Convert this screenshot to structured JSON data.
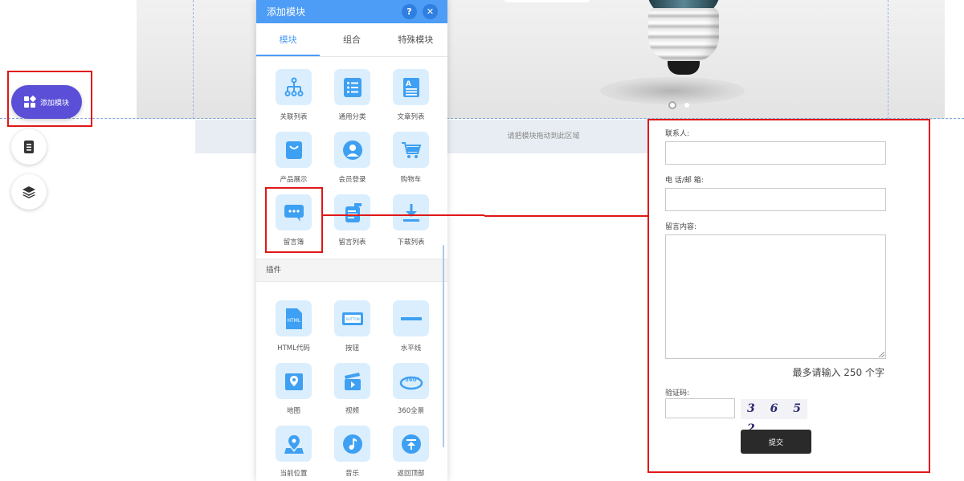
{
  "canvas": {
    "drop_hint": "请把模块拖动到此区域"
  },
  "tool_rail": {
    "add_module_label": "添加模块",
    "tools": [
      "page-icon",
      "layers-icon"
    ]
  },
  "panel": {
    "title": "添加模块",
    "help_label": "?",
    "close_label": "✕",
    "tabs": [
      {
        "label": "模块",
        "active": true
      },
      {
        "label": "组合",
        "active": false
      },
      {
        "label": "特殊模块",
        "active": false
      }
    ],
    "modules": [
      {
        "label": "关联列表",
        "icon": "tree-icon"
      },
      {
        "label": "通用分类",
        "icon": "list-icon"
      },
      {
        "label": "文章列表",
        "icon": "article-icon"
      },
      {
        "label": "产品展示",
        "icon": "bag-icon"
      },
      {
        "label": "会员登录",
        "icon": "user-icon"
      },
      {
        "label": "购物车",
        "icon": "cart-icon"
      },
      {
        "label": "留言簿",
        "icon": "chat-icon"
      },
      {
        "label": "留言列表",
        "icon": "message-list-icon"
      },
      {
        "label": "下载列表",
        "icon": "download-icon"
      }
    ],
    "plugins_title": "插件",
    "plugins": [
      {
        "label": "HTML代码",
        "icon": "html-icon",
        "icon_text": "HTML"
      },
      {
        "label": "按钮",
        "icon": "button-icon",
        "icon_text": "BUTTON"
      },
      {
        "label": "水平线",
        "icon": "hr-icon",
        "icon_text": ""
      },
      {
        "label": "地图",
        "icon": "map-icon",
        "icon_text": ""
      },
      {
        "label": "视频",
        "icon": "video-icon",
        "icon_text": ""
      },
      {
        "label": "360全景",
        "icon": "panorama-icon",
        "icon_text": "360°"
      },
      {
        "label": "当前位置",
        "icon": "location-icon",
        "icon_text": ""
      },
      {
        "label": "音乐",
        "icon": "music-icon",
        "icon_text": ""
      },
      {
        "label": "返回顶部",
        "icon": "back-to-top-icon",
        "icon_text": ""
      }
    ]
  },
  "form": {
    "contact_label": "联系人:",
    "contact_value": "",
    "phone_label": "电 话/邮 箱:",
    "phone_value": "",
    "content_label": "留言内容:",
    "content_value": "",
    "limit_hint": "最多请输入 250 个字",
    "captcha_label": "验证码:",
    "captcha_value": "",
    "captcha_text": "3 6 5 2",
    "submit_label": "提交"
  },
  "colors": {
    "accent": "#4d9cf5",
    "add_button": "#5a4fd6",
    "highlight": "#e01818",
    "icon_tile": "#dbeefd",
    "submit": "#2a2a2a"
  }
}
